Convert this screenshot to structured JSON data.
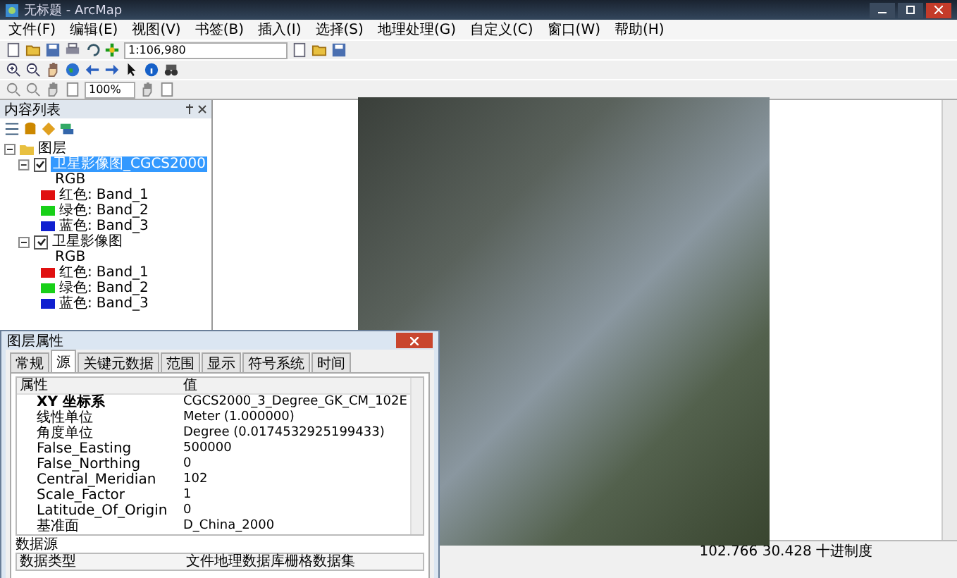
{
  "window": {
    "title": "无标题 - ArcMap"
  },
  "menu": [
    "文件(F)",
    "编辑(E)",
    "视图(V)",
    "书签(B)",
    "插入(I)",
    "选择(S)",
    "地理处理(G)",
    "自定义(C)",
    "窗口(W)",
    "帮助(H)"
  ],
  "toolbar": {
    "scale": "1:106,980",
    "zoom": "100%"
  },
  "toc": {
    "title": "内容列表",
    "root": {
      "label": "图层",
      "expanded": true,
      "children": [
        {
          "label": "卫星影像图_CGCS2000",
          "checked": true,
          "selected": true,
          "expanded": true,
          "renderer": "RGB",
          "bands": [
            {
              "label": "红色:",
              "band": "Band_1",
              "color": "#e01010"
            },
            {
              "label": "绿色:",
              "band": "Band_2",
              "color": "#18d018"
            },
            {
              "label": "蓝色:",
              "band": "Band_3",
              "color": "#1020d0"
            }
          ]
        },
        {
          "label": "卫星影像图",
          "checked": true,
          "selected": false,
          "expanded": true,
          "renderer": "RGB",
          "bands": [
            {
              "label": "红色:",
              "band": "Band_1",
              "color": "#e01010"
            },
            {
              "label": "绿色:",
              "band": "Band_2",
              "color": "#18d018"
            },
            {
              "label": "蓝色:",
              "band": "Band_3",
              "color": "#1020d0"
            }
          ]
        }
      ]
    }
  },
  "dialog": {
    "title": "图层属性",
    "tabs": [
      {
        "label": "常规",
        "selected": false
      },
      {
        "label": "源",
        "selected": true
      },
      {
        "label": "关键元数据",
        "selected": false
      },
      {
        "label": "范围",
        "selected": false
      },
      {
        "label": "显示",
        "selected": false
      },
      {
        "label": "符号系统",
        "selected": false
      },
      {
        "label": "时间",
        "selected": false
      }
    ],
    "columns": [
      "属性",
      "值"
    ],
    "rows": [
      {
        "kind": "group",
        "name": "XY 坐标系",
        "value": "CGCS2000_3_Degree_GK_CM_102E"
      },
      {
        "kind": "property",
        "name": "线性单位",
        "value": "Meter (1.000000)"
      },
      {
        "kind": "property",
        "name": "角度单位",
        "value": "Degree (0.0174532925199433)"
      },
      {
        "kind": "property",
        "name": "False_Easting",
        "value": "500000"
      },
      {
        "kind": "property",
        "name": "False_Northing",
        "value": "0"
      },
      {
        "kind": "property",
        "name": "Central_Meridian",
        "value": "102"
      },
      {
        "kind": "property",
        "name": "Scale_Factor",
        "value": "1"
      },
      {
        "kind": "property",
        "name": "Latitude_Of_Origin",
        "value": "0"
      },
      {
        "kind": "property",
        "name": "基准面",
        "value": "D_China_2000"
      }
    ],
    "section": "数据源",
    "source_rows": [
      {
        "name": "数据类型",
        "value": "文件地理数据库栅格数据集"
      }
    ]
  },
  "status_bar": {
    "coordinates": "102.766  30.428 十进制度"
  }
}
